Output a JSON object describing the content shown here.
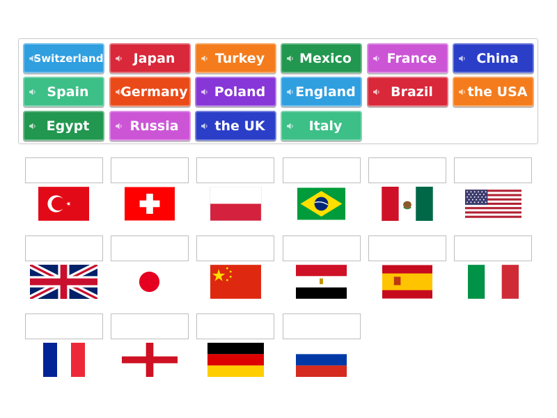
{
  "tiles": [
    {
      "label": "Switzerland",
      "color": "#2f9fe0",
      "icon": "speaker-icon"
    },
    {
      "label": "Japan",
      "color": "#d8283a",
      "icon": "speaker-icon"
    },
    {
      "label": "Turkey",
      "color": "#f47c1c",
      "icon": "speaker-icon"
    },
    {
      "label": "Mexico",
      "color": "#22974f",
      "icon": "speaker-icon"
    },
    {
      "label": "France",
      "color": "#cc55d6",
      "icon": "speaker-icon"
    },
    {
      "label": "China",
      "color": "#2a3ec8",
      "icon": "speaker-icon"
    },
    {
      "label": "Spain",
      "color": "#3dbf88",
      "icon": "speaker-icon"
    },
    {
      "label": "Germany",
      "color": "#ea4a18",
      "icon": "speaker-icon"
    },
    {
      "label": "Poland",
      "color": "#8736d8",
      "icon": "speaker-icon"
    },
    {
      "label": "England",
      "color": "#2f9fe0",
      "icon": "speaker-icon"
    },
    {
      "label": "Brazil",
      "color": "#d8283a",
      "icon": "speaker-icon"
    },
    {
      "label": "the USA",
      "color": "#f47c1c",
      "icon": "speaker-icon"
    },
    {
      "label": "Egypt",
      "color": "#22974f",
      "icon": "speaker-icon"
    },
    {
      "label": "Russia",
      "color": "#cc55d6",
      "icon": "speaker-icon"
    },
    {
      "label": "the UK",
      "color": "#2a3ec8",
      "icon": "speaker-icon"
    },
    {
      "label": "Italy",
      "color": "#3dbf88",
      "icon": "speaker-icon"
    }
  ],
  "flags": [
    "turkey-flag",
    "switzerland-flag",
    "poland-flag",
    "brazil-flag",
    "mexico-flag",
    "usa-flag",
    "uk-flag",
    "japan-flag",
    "china-flag",
    "egypt-flag",
    "spain-flag",
    "italy-flag",
    "france-flag",
    "england-flag",
    "germany-flag",
    "russia-flag"
  ]
}
